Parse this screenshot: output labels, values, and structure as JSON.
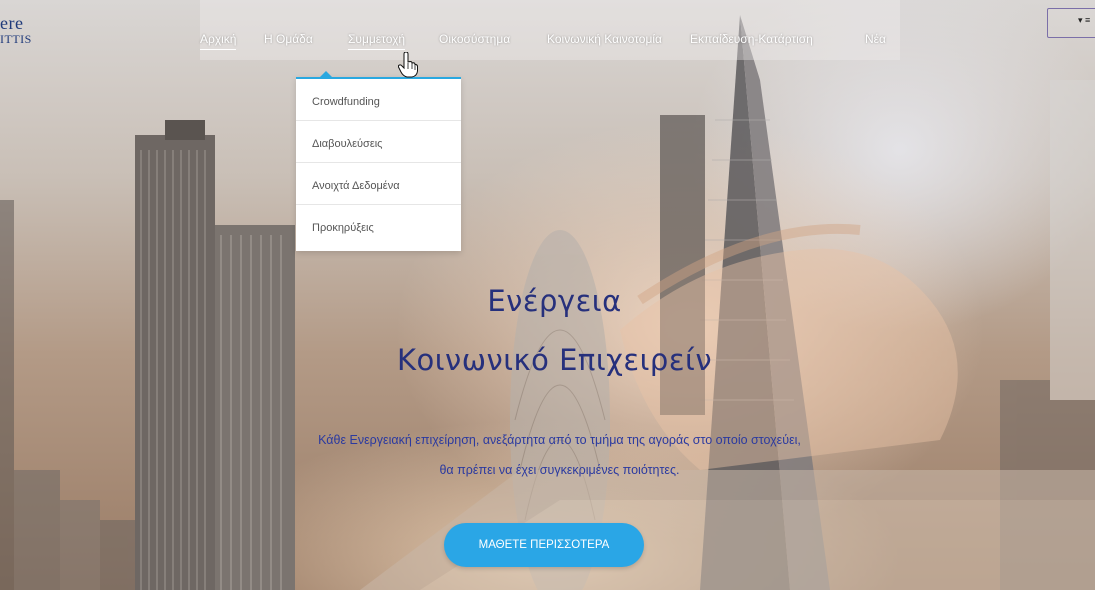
{
  "brand": {
    "line1": "ere",
    "line2": "ITTIS"
  },
  "nav": {
    "items": [
      {
        "label": "Αρχική"
      },
      {
        "label": "Η Ομάδα"
      },
      {
        "label": "Συμμετοχή"
      },
      {
        "label": "Οικοσύστημα"
      },
      {
        "label": "Κοινωνική Καινοτομία"
      },
      {
        "label": "Εκπαίδευση-Κατάρτιση"
      },
      {
        "label": "Νέα"
      }
    ]
  },
  "corner_button": {
    "icon": "caret-down-icon",
    "glyph": "▾ ≡"
  },
  "dropdown": {
    "items": [
      {
        "label": "Crowdfunding"
      },
      {
        "label": "Διαβουλεύσεις"
      },
      {
        "label": "Ανοιχτά Δεδομένα"
      },
      {
        "label": "Προκηρύξεις"
      }
    ]
  },
  "hero": {
    "title_line1": "Ενέργεια",
    "title_line2": "Κοινωνικό Επιχειρείν",
    "subtitle_line1": "Κάθε Ενεργειακή επιχείρηση, ανεξάρτητα από το τμήμα της αγοράς στο οποίο στοχεύει,",
    "subtitle_line2": "θα πρέπει να έχει συγκεκριμένες ποιότητες.",
    "cta_label": "ΜΑΘΕΤΕ ΠΕΡΙΣΣΟΤΕΡΑ"
  },
  "colors": {
    "accent": "#29a8e0",
    "headline": "#26307c",
    "subtitle": "#2b3aa0",
    "cta": "#2aa6e6"
  }
}
